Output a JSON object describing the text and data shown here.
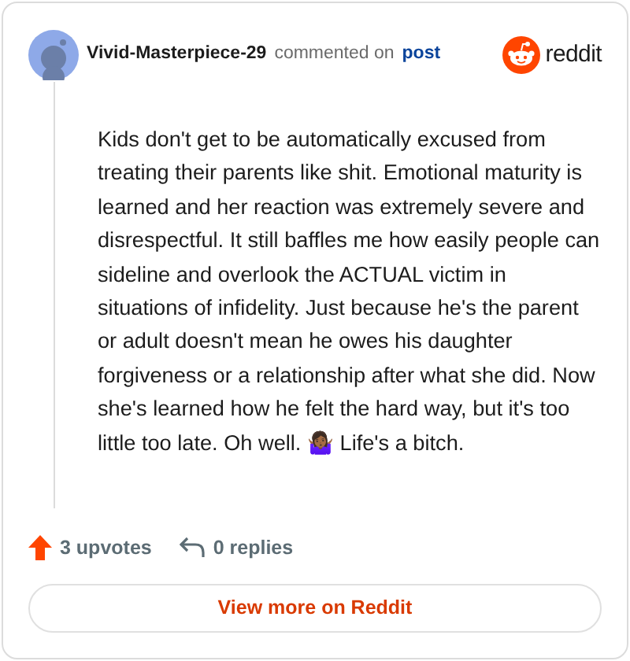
{
  "author": "Vivid-Masterpiece-29",
  "action": "commented on",
  "post_link": "post",
  "brand": "reddit",
  "comment": "Kids don't get to be automatically excused from treating their parents like shit. Emotional maturity is learned and her reaction was extremely severe and disrespectful. It still baffles me how easily people can sideline and overlook the ACTUAL victim in situations of infidelity. Just because he's the parent or adult doesn't mean he owes his daughter forgiveness or a relationship after what she did. Now she's learned how he felt the hard way, but it's too little too late. Oh well. 🤷🏾‍♀️ Life's a bitch.",
  "upvotes": "3 upvotes",
  "replies": "0 replies",
  "button": "View more on Reddit"
}
